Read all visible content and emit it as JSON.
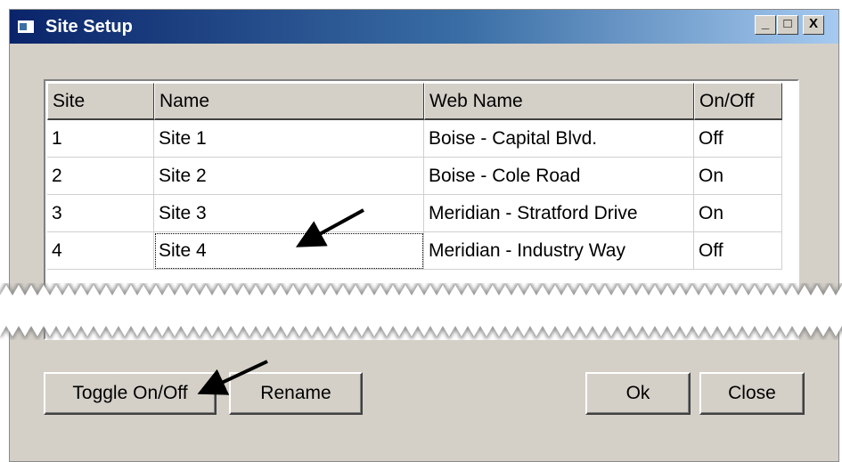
{
  "window": {
    "title": "Site Setup",
    "controls": {
      "minimize": "_",
      "maximize": "□",
      "close": "X"
    }
  },
  "grid": {
    "columns": [
      "Site",
      "Name",
      "Web Name",
      "On/Off"
    ],
    "rows": [
      [
        "1",
        "Site 1",
        "Boise - Capital Blvd.",
        "Off"
      ],
      [
        "2",
        "Site 2",
        "Boise - Cole Road",
        "On"
      ],
      [
        "3",
        "Site 3",
        "Meridian - Stratford Drive",
        "On"
      ],
      [
        "4",
        "Site 4",
        "Meridian - Industry Way",
        "Off"
      ]
    ],
    "focused_cell": "Site 4"
  },
  "buttons": {
    "toggle": "Toggle On/Off",
    "rename": "Rename",
    "ok": "Ok",
    "close": "Close"
  },
  "colors": {
    "titlebar_start": "#0a246a",
    "titlebar_end": "#a6caf0",
    "window_face": "#d4d0c8",
    "annotation_arrow": "#000000"
  },
  "icons": [
    "window-app-icon",
    "minimize-icon",
    "maximize-icon",
    "close-icon",
    "annotation-arrow"
  ]
}
